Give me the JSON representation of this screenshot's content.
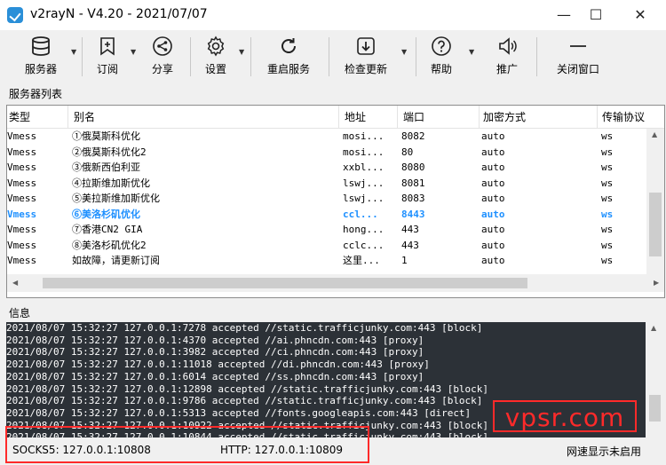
{
  "window": {
    "title": "v2rayN - V4.20 - 2021/07/07",
    "minimize": "—",
    "maximize": "☐",
    "close": "✕"
  },
  "toolbar": {
    "items": [
      {
        "label": "服务器",
        "icon": "database-icon",
        "dropdown": true
      },
      {
        "label": "订阅",
        "icon": "bookmark-add-icon",
        "dropdown": true
      },
      {
        "label": "分享",
        "icon": "share-icon",
        "dropdown": false
      },
      {
        "label": "设置",
        "icon": "gear-icon",
        "dropdown": true
      },
      {
        "label": "重启服务",
        "icon": "restart-icon",
        "dropdown": false
      },
      {
        "label": "检查更新",
        "icon": "download-icon",
        "dropdown": true
      },
      {
        "label": "帮助",
        "icon": "help-icon",
        "dropdown": true
      },
      {
        "label": "推广",
        "icon": "speaker-icon",
        "dropdown": false
      },
      {
        "label": "关闭窗口",
        "icon": "minimize-icon",
        "dropdown": false
      }
    ]
  },
  "servers": {
    "label": "服务器列表",
    "columns": [
      "类型",
      "别名",
      "地址",
      "端口",
      "加密方式",
      "传输协议"
    ],
    "rows": [
      {
        "type": "Vmess",
        "alias": "①俄莫斯科优化",
        "address": "mosi...",
        "port": "8082",
        "security": "auto",
        "network": "ws",
        "active": false
      },
      {
        "type": "Vmess",
        "alias": "②俄莫斯科优化2",
        "address": "mosi...",
        "port": "80",
        "security": "auto",
        "network": "ws",
        "active": false
      },
      {
        "type": "Vmess",
        "alias": "③俄新西伯利亚",
        "address": "xxbl...",
        "port": "8080",
        "security": "auto",
        "network": "ws",
        "active": false
      },
      {
        "type": "Vmess",
        "alias": "④拉斯维加斯优化",
        "address": "lswj...",
        "port": "8081",
        "security": "auto",
        "network": "ws",
        "active": false
      },
      {
        "type": "Vmess",
        "alias": "⑤美拉斯维加斯优化",
        "address": "lswj...",
        "port": "8083",
        "security": "auto",
        "network": "ws",
        "active": false
      },
      {
        "type": "Vmess",
        "alias": "⑥美洛杉矶优化",
        "address": "ccl...",
        "port": "8443",
        "security": "auto",
        "network": "ws",
        "active": true
      },
      {
        "type": "Vmess",
        "alias": "⑦香港CN2 GIA",
        "address": "hong...",
        "port": "443",
        "security": "auto",
        "network": "ws",
        "active": false
      },
      {
        "type": "Vmess",
        "alias": "⑧美洛杉矶优化2",
        "address": "cclc...",
        "port": "443",
        "security": "auto",
        "network": "ws",
        "active": false
      },
      {
        "type": "Vmess",
        "alias": "如故障，请更新订阅",
        "address": "这里...",
        "port": "1",
        "security": "auto",
        "network": "ws",
        "active": false
      }
    ]
  },
  "log": {
    "label": "信息",
    "lines": [
      "2021/08/07 15:32:27 127.0.0.1:7278 accepted //static.trafficjunky.com:443 [block]",
      "2021/08/07 15:32:27 127.0.0.1:4370 accepted //ai.phncdn.com:443 [proxy]",
      "2021/08/07 15:32:27 127.0.0.1:3982 accepted //ci.phncdn.com:443 [proxy]",
      "2021/08/07 15:32:27 127.0.0.1:11018 accepted //di.phncdn.com:443 [proxy]",
      "2021/08/07 15:32:27 127.0.0.1:6014 accepted //ss.phncdn.com:443 [proxy]",
      "2021/08/07 15:32:27 127.0.0.1:12898 accepted //static.trafficjunky.com:443 [block]",
      "2021/08/07 15:32:27 127.0.0.1:9786 accepted //static.trafficjunky.com:443 [block]",
      "2021/08/07 15:32:27 127.0.0.1:5313 accepted //fonts.googleapis.com:443 [direct]",
      "2021/08/07 15:32:27 127.0.0.1:10922 accepted //static.trafficjunky.com:443 [block]",
      "2021/08/07 15:32:27 127.0.0.1:10844 accepted //static.trafficjunky.com:443 [block]"
    ]
  },
  "watermark": "vpsr.com",
  "status": {
    "socks": "SOCKS5:  127.0.0.1:10808",
    "http": "HTTP:  127.0.0.1:10809",
    "speed": "网速显示未启用"
  }
}
